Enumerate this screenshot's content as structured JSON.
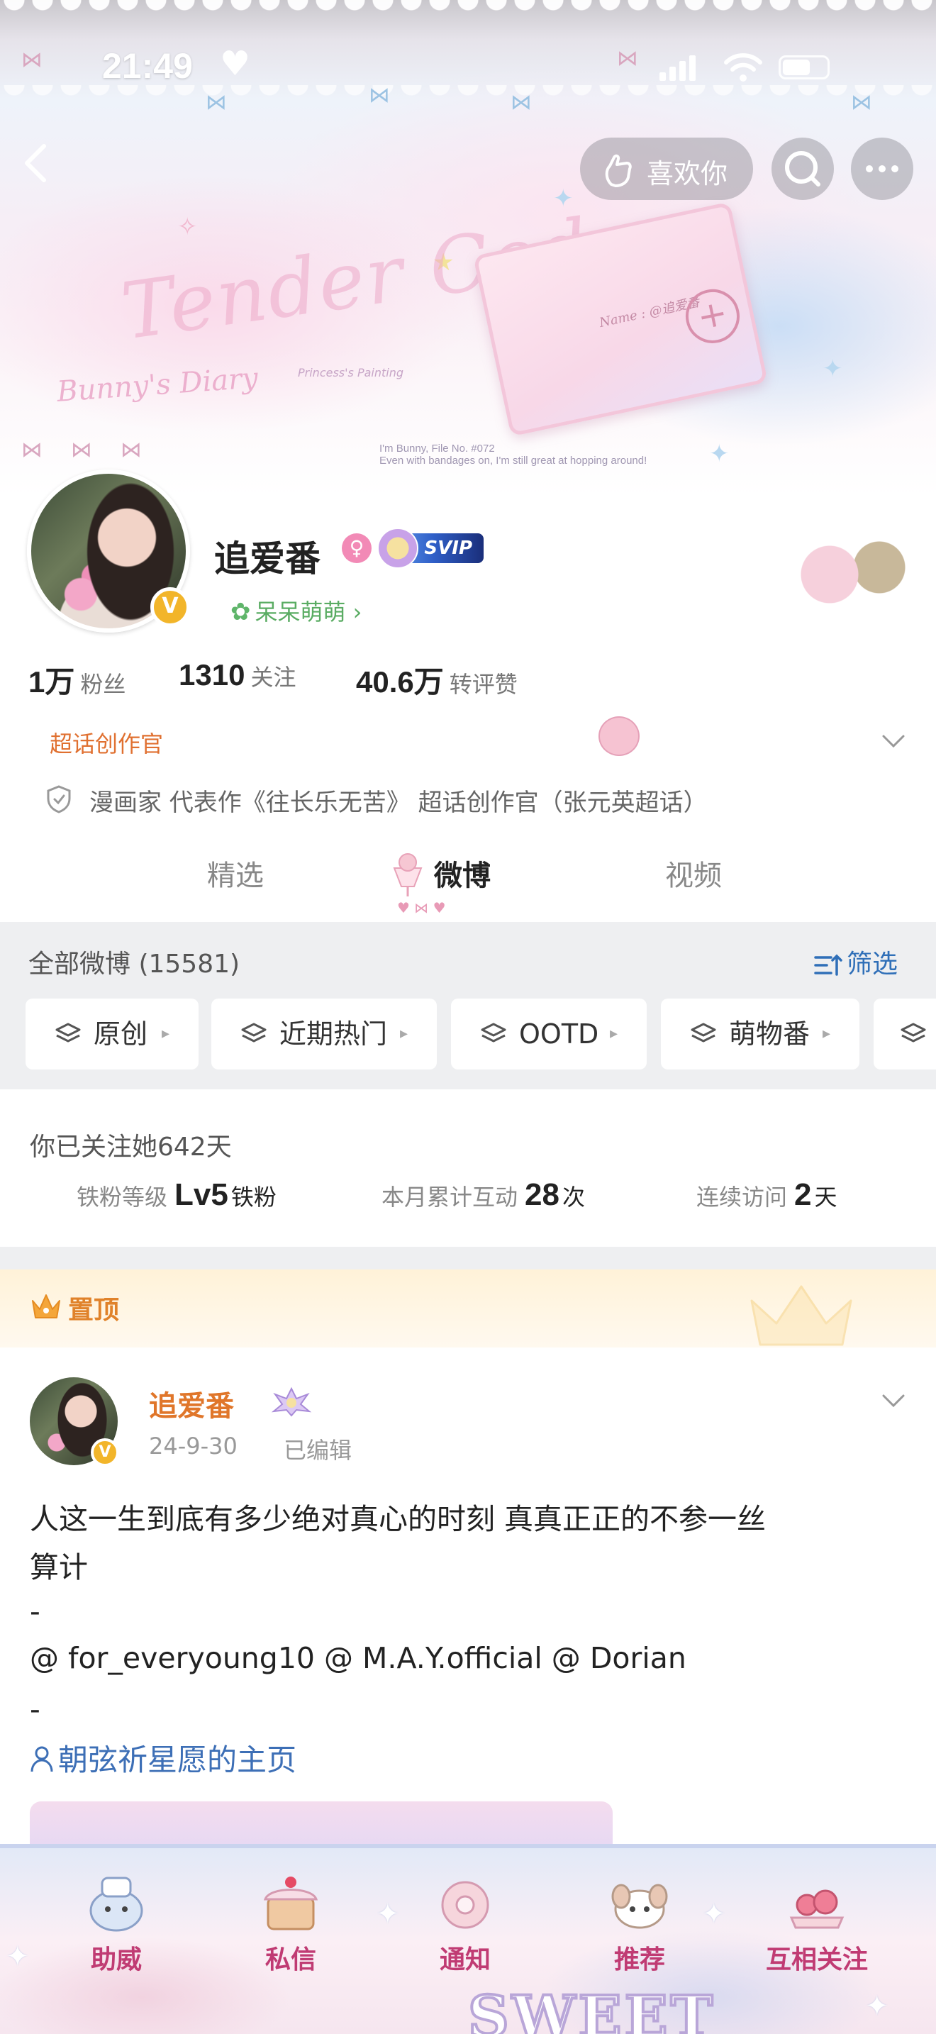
{
  "status_bar": {
    "time": "21:49",
    "heart": "♥"
  },
  "banner": {
    "title": "Tender Code",
    "subtitle": "Bunny's Diary",
    "caption": "Princess's Painting",
    "note_line1": "I'm Bunny, File No. #072",
    "note_line2": "Even with bandages on, I'm still great at hopping around!",
    "card_name": "Name : @追爱番"
  },
  "header": {
    "like_label": "喜欢你",
    "like_icon": "hand-heart-icon",
    "search_icon": "search-icon",
    "more_icon": "more-icon",
    "back_icon": "back-icon"
  },
  "profile": {
    "name": "追爱番",
    "gender_icon": "female-icon",
    "vip_label": "SVIP",
    "verified_mark": "V",
    "group_label": "呆呆萌萌 ›",
    "stats": [
      {
        "num": "1万",
        "label": "粉丝"
      },
      {
        "num": "1310",
        "label": "关注"
      },
      {
        "num": "40.6万",
        "label": "转评赞"
      }
    ],
    "creator_tag": "超话创作官",
    "bio": "漫画家 代表作《往长乐无苦》 超话创作官（张元英超话）"
  },
  "tabs": [
    {
      "label": "精选",
      "active": false
    },
    {
      "label": "微博",
      "active": true
    },
    {
      "label": "视频",
      "active": false
    }
  ],
  "filter": {
    "all_label": "全部微博 (15581)",
    "filter_label": "筛选",
    "chips": [
      "原创",
      "近期热门",
      "OOTD",
      "萌物番"
    ]
  },
  "fan": {
    "follow_days": "你已关注她642天",
    "stats": [
      {
        "label": "铁粉等级",
        "value": "Lv5",
        "unit": "铁粉"
      },
      {
        "label": "本月累计互动",
        "value": "28",
        "unit": "次"
      },
      {
        "label": "连续访问",
        "value": "2",
        "unit": "天"
      }
    ]
  },
  "pinned": {
    "label": "置顶"
  },
  "post": {
    "author": "追爱番",
    "date": "24-9-30",
    "edited": "已编辑",
    "lines": [
      "人这一生到底有多少绝对真心的时刻 真真正正的不参一丝",
      "算计",
      "-",
      "@ for_everyoung10 @ M.A.Y.official @ Dorian",
      "-"
    ],
    "link": "朝弦祈星愿的主页"
  },
  "bottom_bar": {
    "items": [
      {
        "label": "助威",
        "icon": "cheer-icon"
      },
      {
        "label": "私信",
        "icon": "message-icon"
      },
      {
        "label": "通知",
        "icon": "notify-icon"
      },
      {
        "label": "推荐",
        "icon": "recommend-icon"
      },
      {
        "label": "互相关注",
        "icon": "mutual-follow-icon"
      }
    ],
    "decor_text": "SWEET"
  },
  "colors": {
    "accent_orange": "#e0762a",
    "link_blue": "#3d6fb6",
    "group_green": "#5aac63",
    "bottom_label": "#c03b73"
  }
}
